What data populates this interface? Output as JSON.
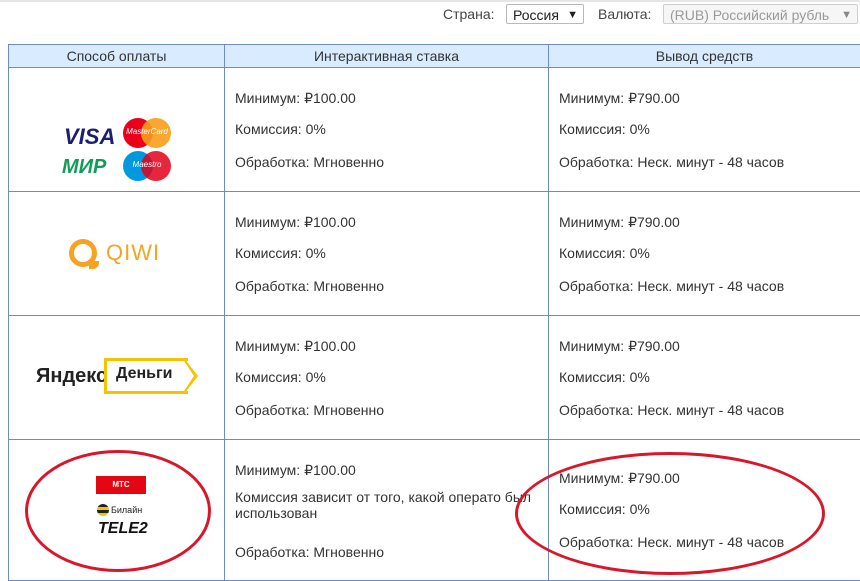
{
  "filters": {
    "country_label": "Страна:",
    "country_value": "Россия",
    "currency_label": "Валюта:",
    "currency_value": "(RUB) Российский рубль"
  },
  "table": {
    "headers": [
      "Способ оплаты",
      "Интерактивная ставка",
      "Вывод средств"
    ],
    "rows": [
      {
        "method": "visa-mastercard-mir-maestro",
        "logos": {
          "visa": "VISA",
          "mastercard": "MasterCard",
          "mir": "МИР",
          "maestro": "Maestro"
        },
        "bet_min": "Минимум: ₽100.00",
        "bet_fee": "Комиссия: 0%",
        "bet_processing": "Обработка: Мгновенно",
        "out_min": "Минимум: ₽790.00",
        "out_fee": "Комиссия: 0%",
        "out_processing": "Обработка: Неск. минут - 48 часов"
      },
      {
        "method": "qiwi",
        "logos": {
          "qiwi": "QIWI"
        },
        "bet_min": "Минимум: ₽100.00",
        "bet_fee": "Комиссия: 0%",
        "bet_processing": "Обработка: Мгновенно",
        "out_min": "Минимум: ₽790.00",
        "out_fee": "Комиссия: 0%",
        "out_processing": "Обработка: Неск. минут - 48 часов"
      },
      {
        "method": "yandex-money",
        "logos": {
          "yandex": "Яндекс",
          "dengi": "Деньги"
        },
        "bet_min": "Минимум: ₽100.00",
        "bet_fee": "Комиссия: 0%",
        "bet_processing": "Обработка: Мгновенно",
        "out_min": "Минимум: ₽790.00",
        "out_fee": "Комиссия: 0%",
        "out_processing": "Обработка: Неск. минут - 48 часов"
      },
      {
        "method": "mobile-operators",
        "logos": {
          "mts": "МТС",
          "beeline": "Билайн",
          "tele2": "TELE2"
        },
        "bet_min": "Минимум: ₽100.00",
        "bet_fee": "Комиссия зависит от того, какой операто был использован",
        "bet_processing": "Обработка: Мгновенно",
        "out_min": "Минимум: ₽790.00",
        "out_fee": "Комиссия: 0%",
        "out_processing": "Обработка: Неск. минут - 48 часов"
      }
    ]
  },
  "colors": {
    "header_bg": "#d9ecff",
    "border": "#6b8cc8",
    "highlight": "#d9172a"
  }
}
